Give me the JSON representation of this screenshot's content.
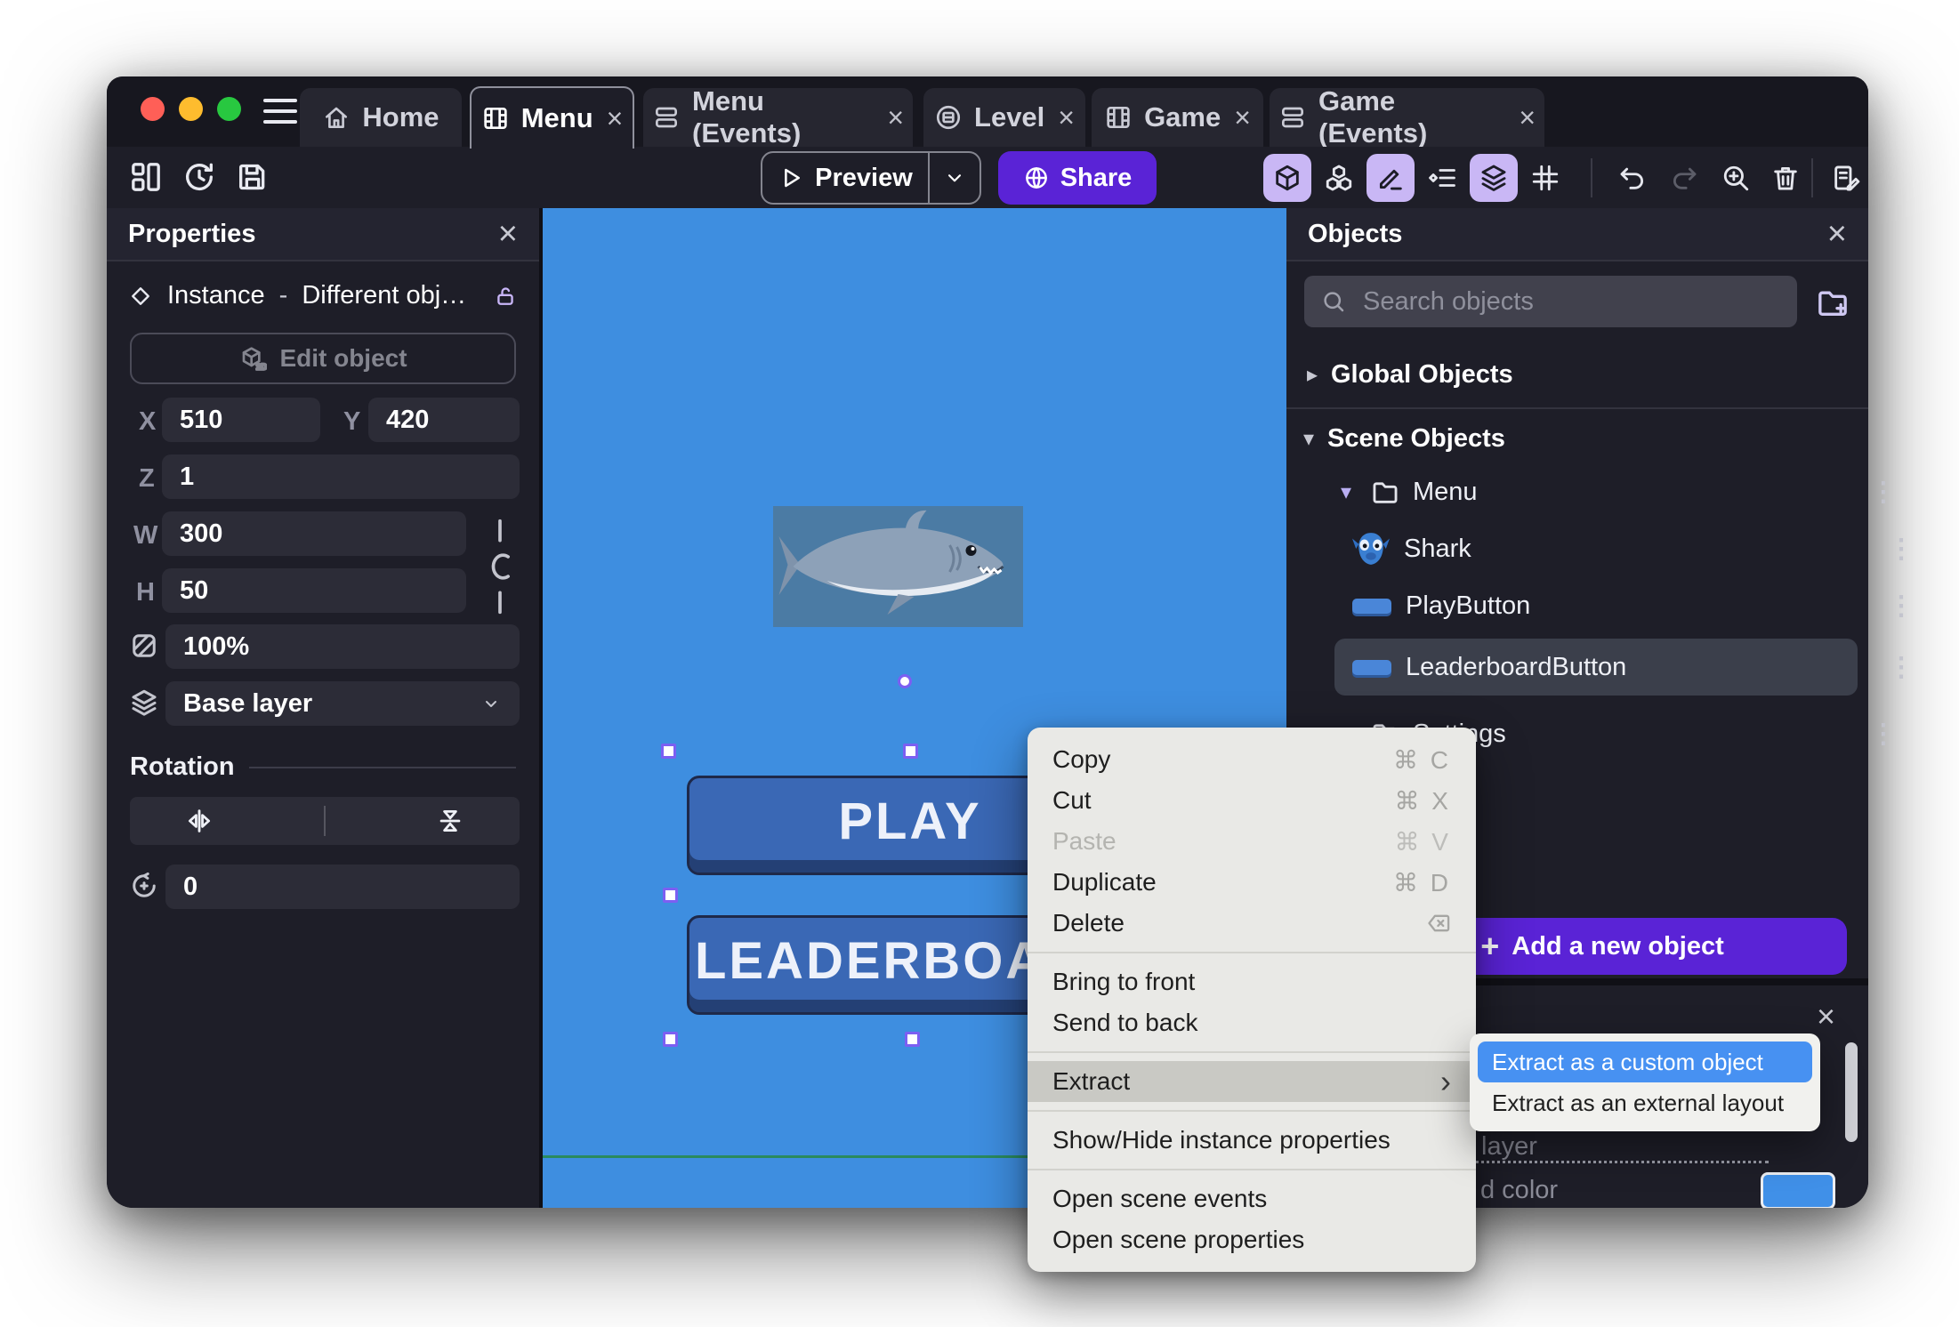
{
  "tabs": [
    {
      "label": "Home",
      "icon": "home-icon",
      "active": false,
      "closable": false
    },
    {
      "label": "Menu",
      "icon": "scene-icon",
      "active": true,
      "closable": true
    },
    {
      "label": "Menu (Events)",
      "icon": "events-icon",
      "active": false,
      "closable": true
    },
    {
      "label": "Level",
      "icon": "external-layout-icon",
      "active": false,
      "closable": true
    },
    {
      "label": "Game",
      "icon": "scene-icon",
      "active": false,
      "closable": true
    },
    {
      "label": "Game (Events)",
      "icon": "events-icon",
      "active": false,
      "closable": true
    }
  ],
  "toolbar": {
    "preview_label": "Preview",
    "share_label": "Share"
  },
  "properties_panel": {
    "title": "Properties",
    "instance_type": "Instance",
    "separator": "-",
    "instance_object": "Different obj…",
    "edit_object_label": "Edit object",
    "x_label": "X",
    "x_value": "510",
    "y_label": "Y",
    "y_value": "420",
    "z_label": "Z",
    "z_value": "1",
    "w_label": "W",
    "w_value": "300",
    "h_label": "H",
    "h_value": "50",
    "opacity_value": "100%",
    "layer_value": "Base layer",
    "rotation_title": "Rotation",
    "rotation_value": "0"
  },
  "objects_panel": {
    "title": "Objects",
    "search_placeholder": "Search objects",
    "global_group_label": "Global Objects",
    "scene_group_label": "Scene Objects",
    "menu_folder_label": "Menu",
    "settings_folder_label": "Settings",
    "items": [
      {
        "name": "Shark",
        "selected": false
      },
      {
        "name": "PlayButton",
        "selected": false
      },
      {
        "name": "LeaderboardButton",
        "selected": true
      }
    ],
    "add_button_label": "Add a new object"
  },
  "scene_canvas": {
    "background_color": "#3e8ee0",
    "play_button_text": "PLAY",
    "leaderboard_button_text": "LEADERBOARD",
    "selected_instance": "LeaderboardButton"
  },
  "context_menu": {
    "items": [
      {
        "label": "Copy",
        "shortcut": "⌘ C"
      },
      {
        "label": "Cut",
        "shortcut": "⌘ X"
      },
      {
        "label": "Paste",
        "shortcut": "⌘ V",
        "disabled": true
      },
      {
        "label": "Duplicate",
        "shortcut": "⌘ D"
      },
      {
        "label": "Delete",
        "shortcut_icon": "delete-key-icon"
      },
      {
        "label": "Bring to front"
      },
      {
        "label": "Send to back"
      },
      {
        "label": "Extract",
        "has_submenu": true,
        "highlighted": true
      },
      {
        "label": "Show/Hide instance properties"
      },
      {
        "label": "Open scene events"
      },
      {
        "label": "Open scene properties"
      }
    ]
  },
  "extract_submenu": {
    "items": [
      {
        "label": "Extract as a custom object",
        "highlighted": true
      },
      {
        "label": "Extract as an external layout"
      }
    ]
  },
  "layers_panel": {
    "layer_text_fragment": "layer",
    "color_text_fragment": "d color",
    "swatch_color": "#4090e8"
  },
  "glyphs": {
    "close": "×",
    "kebab": "⋮",
    "caret_right": "▸",
    "caret_down": "▾",
    "submenu_arrow": "›",
    "plus": "+",
    "command": "⌘"
  },
  "colors": {
    "accent_purple": "#5a23d6",
    "toggle_active": "#c9b7f5",
    "selection_purple": "#7c5ff2",
    "menu_highlight": "#c9c9c4",
    "submenu_highlight": "#4791f2",
    "canvas_blue": "#3e8ee0",
    "traffic_red": "#ff5f57",
    "traffic_yellow": "#febc2e",
    "traffic_green": "#28c840"
  }
}
